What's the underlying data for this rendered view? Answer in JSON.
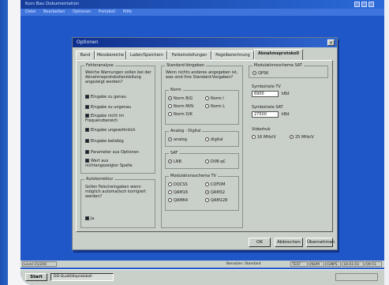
{
  "screen": {
    "title": "Kurs Bau Dokumentation",
    "menu": [
      "Datei",
      "Bearbeiten",
      "Optionen",
      "Protokoll",
      "Hilfe"
    ]
  },
  "dialog": {
    "title": "Optionen",
    "close": "×",
    "tabs": [
      "Band",
      "Messbereiche",
      "Laden/Speichern",
      "Farbeinstellungen",
      "Pegelberechnung",
      "Abnahmeprotokoll"
    ],
    "active_tab": 5,
    "fehleranalyse": {
      "title": "Fehleranalyse",
      "question": "Welche Warnungen sollen bei der Abnahmeprotokollerstellung angezeigt werden?",
      "options": [
        {
          "label": "Eingabe zu genau",
          "checked": true
        },
        {
          "label": "Eingabe zu ungenau",
          "checked": true
        },
        {
          "label": "Eingabe nicht im Frequenzbereich",
          "checked": true
        },
        {
          "label": "Eingabe ungewöhnlich",
          "checked": true
        },
        {
          "label": "Eingabe beliebig",
          "checked": true
        },
        {
          "label": "Parameter aus Optionen",
          "checked": true
        },
        {
          "label": "Wert aus nichtangezeigter Spalte",
          "checked": true
        }
      ]
    },
    "autokorrektur": {
      "title": "Autokorrektur",
      "question": "Sollen Falscheingaben wenn möglich automatisch korrigiert werden?",
      "option": {
        "label": "Ja",
        "checked": true
      }
    },
    "standardvorgaben": {
      "title": "Standard-Vorgaben",
      "text": "Wenn nichts anderes angegeben ist, was sind Ihre Standard-Vorgaben?"
    },
    "norm": {
      "title": "Norm",
      "options": [
        {
          "label": "Norm B/G",
          "selected": true
        },
        {
          "label": "Norm I",
          "selected": false
        },
        {
          "label": "Norm M/N",
          "selected": false
        },
        {
          "label": "Norm L",
          "selected": false
        },
        {
          "label": "Norm D/K",
          "selected": false
        }
      ]
    },
    "analog_digital": {
      "title": "Analog - Digital",
      "options": [
        {
          "label": "analog",
          "selected": true
        },
        {
          "label": "digital",
          "selected": false
        }
      ]
    },
    "sat": {
      "title": "SAT",
      "options": [
        {
          "label": "LNB",
          "selected": true
        },
        {
          "label": "DVB-qC",
          "selected": false
        }
      ]
    },
    "modulation_tv": {
      "title": "Modulationsschema TV",
      "options": [
        {
          "label": "DQCSS",
          "selected": false
        },
        {
          "label": "COFDM",
          "selected": false
        },
        {
          "label": "QAM16",
          "selected": false
        },
        {
          "label": "QAM32",
          "selected": true
        },
        {
          "label": "QAM64",
          "selected": false
        },
        {
          "label": "QAM128",
          "selected": false
        }
      ]
    },
    "modulation_sat": {
      "title": "Modulationsschema SAT",
      "options": [
        {
          "label": "QPSK",
          "selected": true
        }
      ]
    },
    "symbolrate_tv": {
      "label": "Symbolrate TV",
      "value": "6900",
      "unit": "kBd"
    },
    "symbolrate_sat": {
      "label": "Symbolrate SAT",
      "value": "27500",
      "unit": "kBd"
    },
    "videohub": {
      "label": "Videohub",
      "options": [
        {
          "label": "16 MHz/V",
          "selected": false
        },
        {
          "label": "25 MHz/V",
          "selected": true
        }
      ]
    },
    "buttons": {
      "ok": "OK",
      "cancel": "Abbrechen",
      "apply": "Übernehmen"
    }
  },
  "statusbar": {
    "left": "Level 15/200",
    "user": "Benutzer: Standard",
    "cells": [
      "TEST",
      "INUM",
      "IGNPS",
      "18.03.03",
      "09:51"
    ]
  },
  "taskbar": {
    "start": "Start",
    "task": "DD-Qualitätsprotokoll"
  },
  "colors": {
    "desktop": "#1f57c9",
    "dialog_face": "#c9cfc9",
    "titlebar": "#0f2f8c"
  }
}
